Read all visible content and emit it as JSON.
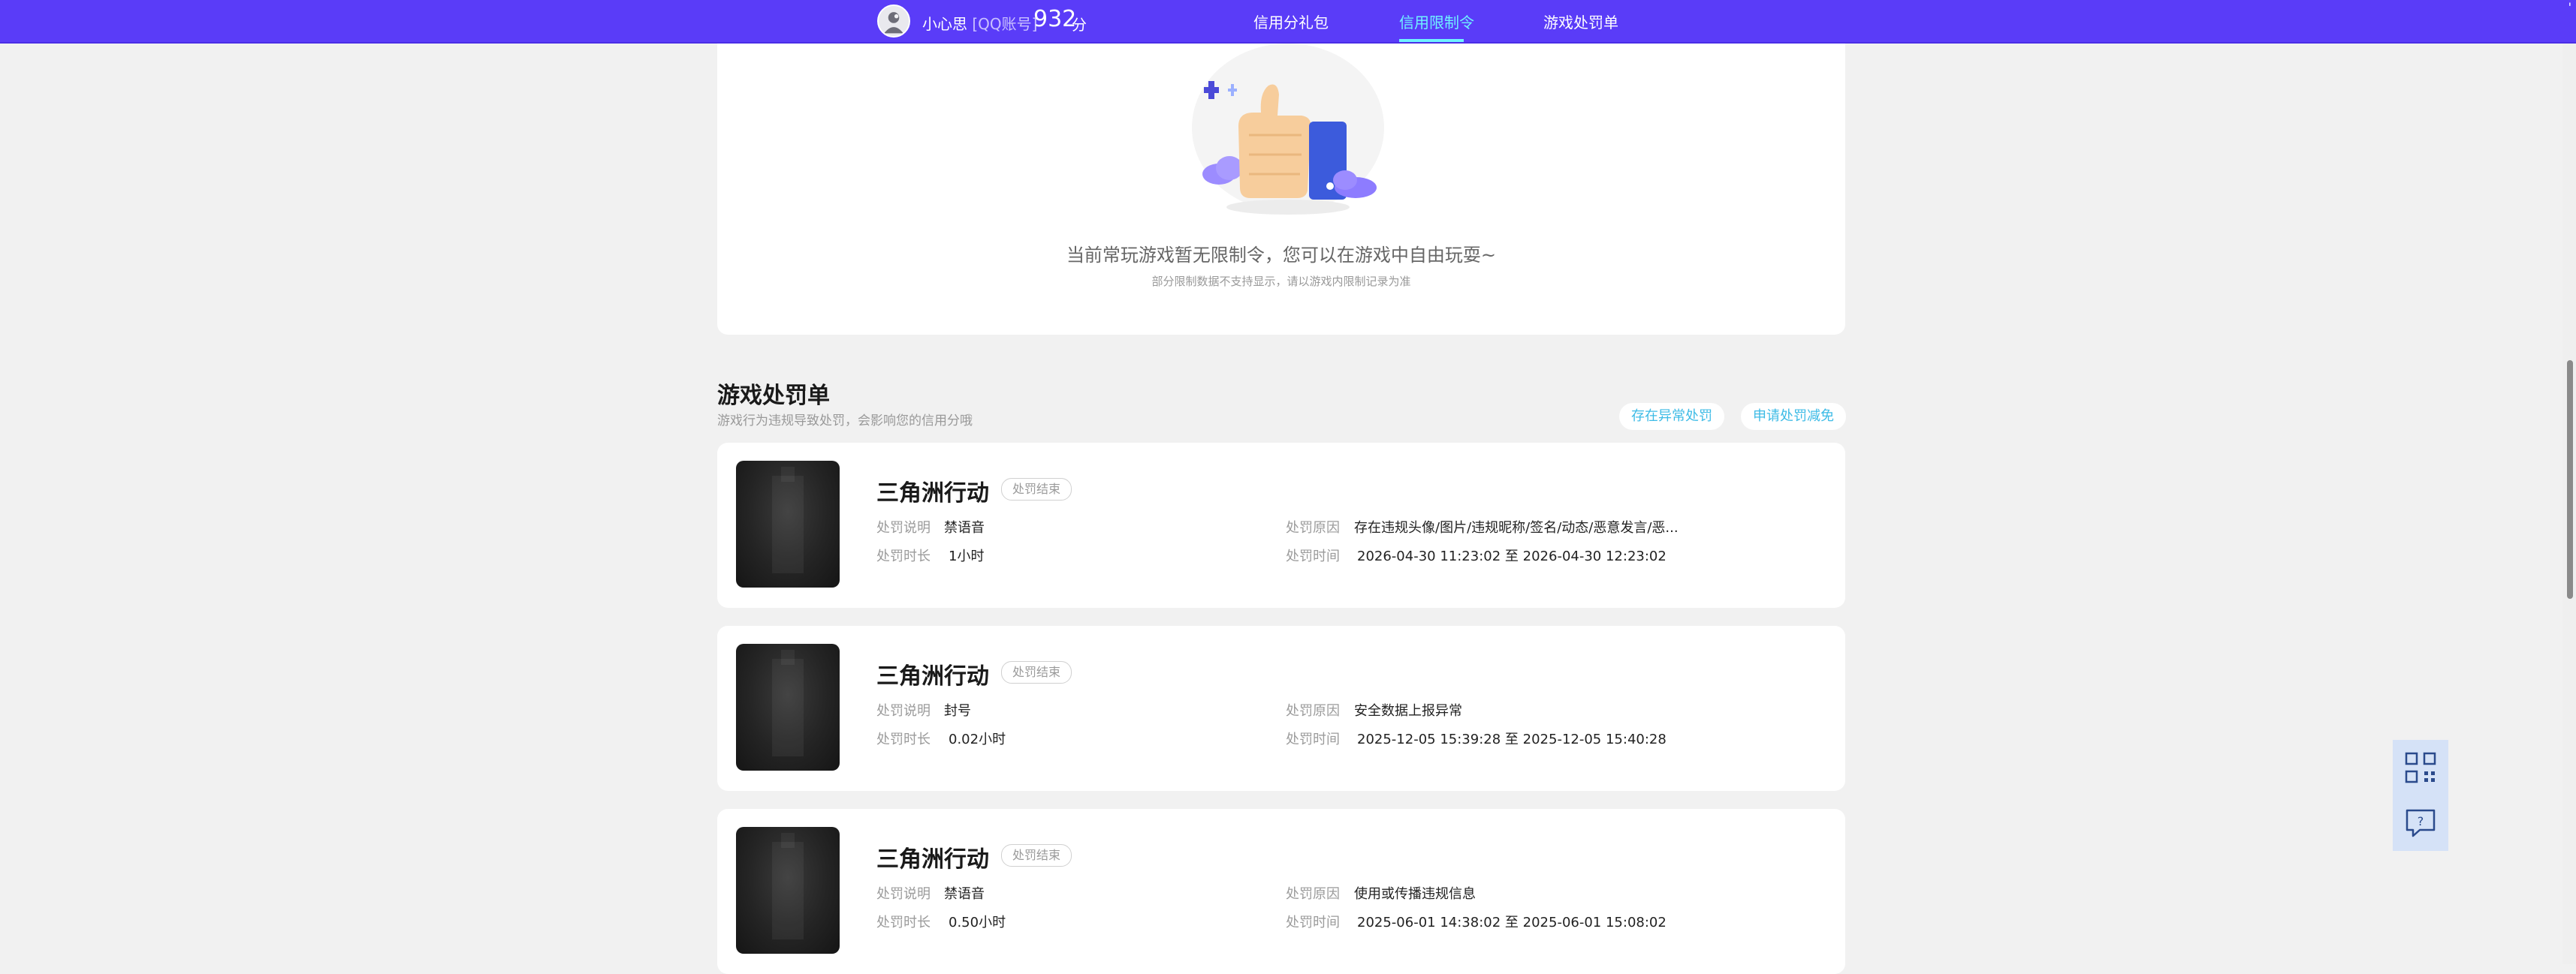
{
  "header": {
    "nickname": "小心思",
    "account_type": "[QQ账号]",
    "score": "932",
    "score_unit": "分",
    "tabs": [
      {
        "label": "信用分礼包",
        "active": false
      },
      {
        "label": "信用限制令",
        "active": true
      },
      {
        "label": "游戏处罚单",
        "active": false
      }
    ],
    "corner_mark": "'"
  },
  "restriction_empty": {
    "message": "当前常玩游戏暂无限制令，您可以在游戏中自由玩耍~",
    "note": "部分限制数据不支持显示，请以游戏内限制记录为准"
  },
  "penalty_section": {
    "title": "游戏处罚单",
    "subtitle": "游戏行为违规导致处罚，会影响您的信用分哦",
    "actions": {
      "abnormal": "存在异常处罚",
      "appeal": "申请处罚减免"
    },
    "labels": {
      "desc": "处罚说明",
      "duration": "处罚时长",
      "reason": "处罚原因",
      "time": "处罚时间",
      "time_sep": "至"
    },
    "items": [
      {
        "game": "三角洲行动",
        "status": "处罚结束",
        "desc": "禁语音",
        "duration": "1小时",
        "reason": "存在违规头像/图片/违规昵称/签名/动态/恶意发言/恶...",
        "start": "2026-04-30 11:23:02",
        "end": "2026-04-30 12:23:02"
      },
      {
        "game": "三角洲行动",
        "status": "处罚结束",
        "desc": "封号",
        "duration": "0.02小时",
        "reason": "安全数据上报异常",
        "start": "2025-12-05 15:39:28",
        "end": "2025-12-05 15:40:28"
      },
      {
        "game": "三角洲行动",
        "status": "处罚结束",
        "desc": "禁语音",
        "duration": "0.50小时",
        "reason": "使用或传播违规信息",
        "start": "2025-06-01 14:38:02",
        "end": "2025-06-01 15:08:02"
      }
    ]
  },
  "side_buttons": {
    "qr_icon": "qr-code-icon",
    "help_icon": "help-chat-icon"
  },
  "colors": {
    "header_bg": "#5a3cf8",
    "active_tab": "#6ff2ff",
    "action_pill_text": "#3dbbe6",
    "page_bg": "#f1f1f1"
  }
}
